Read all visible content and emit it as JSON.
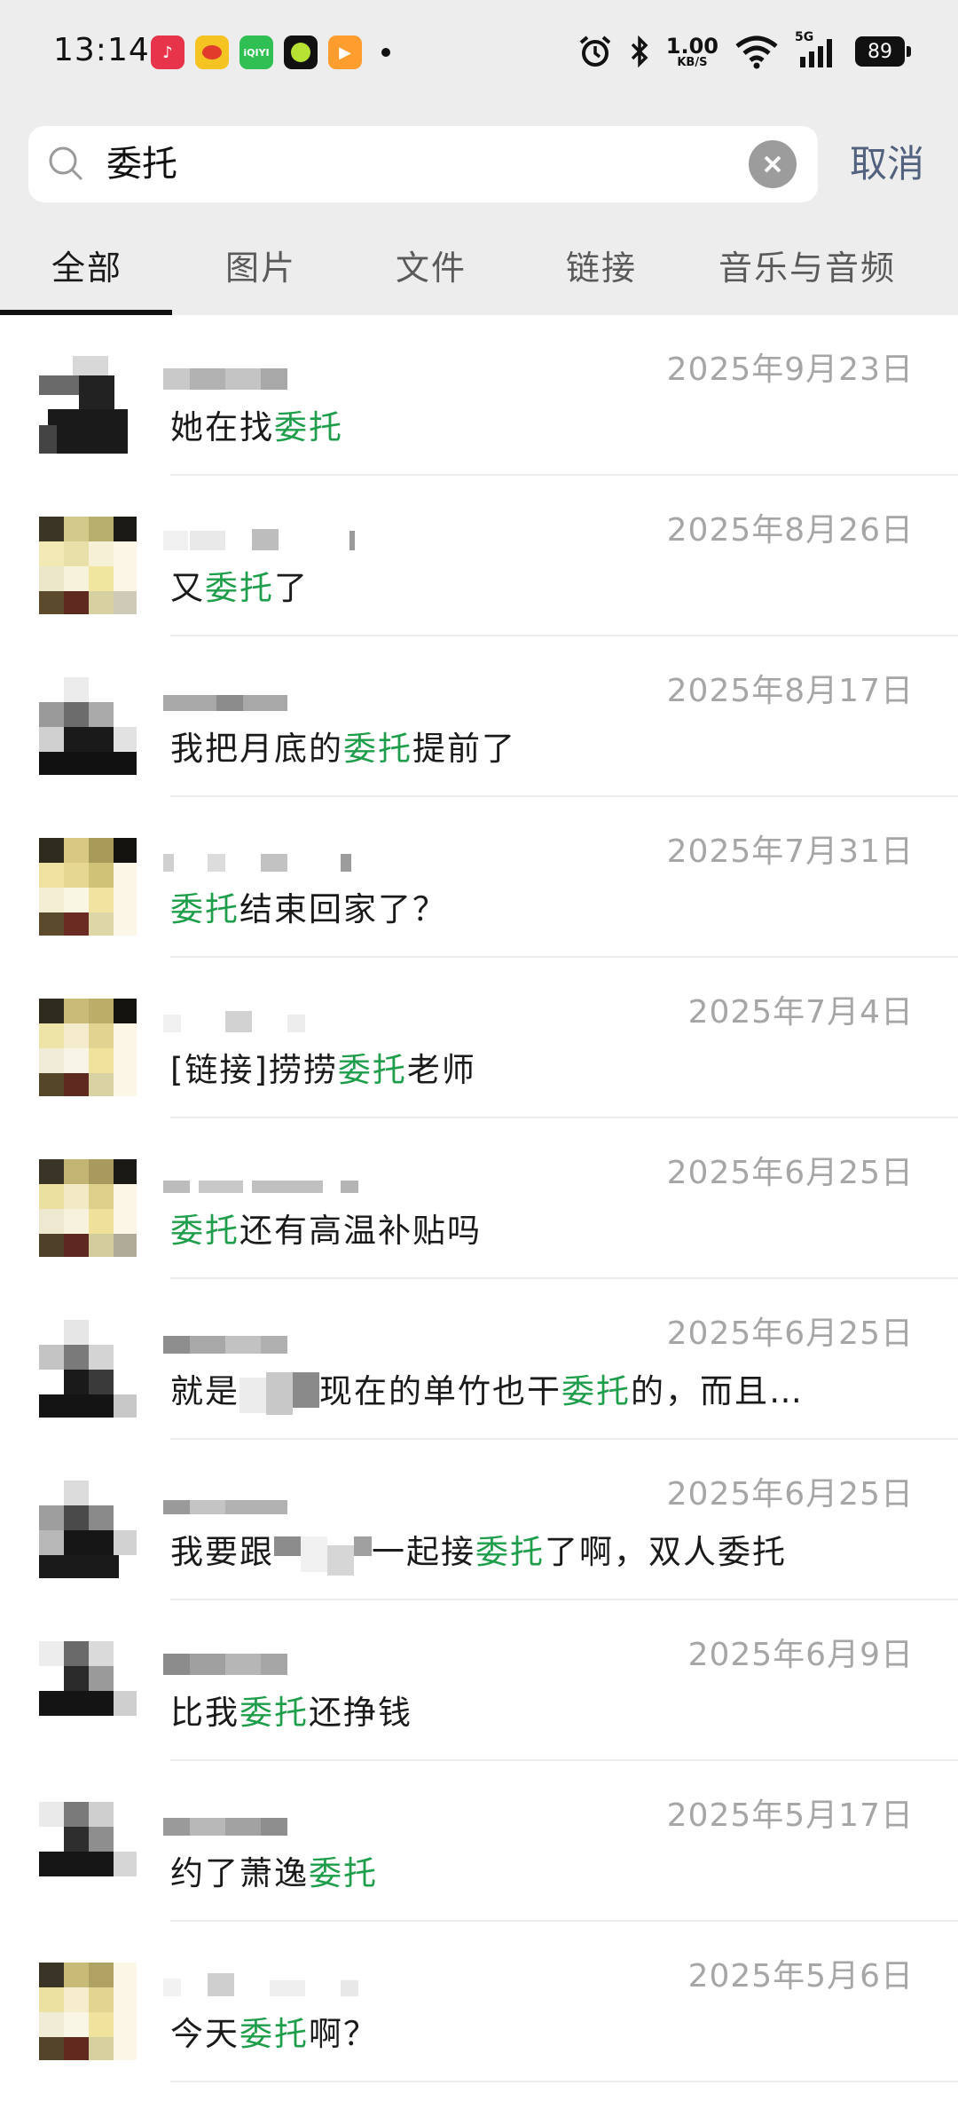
{
  "status_bar": {
    "time": "13:14",
    "net_speed_value": "1.00",
    "net_speed_unit": "KB/S",
    "signal": "5G",
    "battery": "89",
    "app_icons": [
      "music-icon",
      "weibo-icon",
      "iqiyi-icon",
      "green-app-icon",
      "video-app-icon"
    ]
  },
  "search": {
    "query": "委托",
    "cancel_label": "取消"
  },
  "tabs": [
    {
      "label": "全部",
      "active": true
    },
    {
      "label": "图片",
      "active": false
    },
    {
      "label": "文件",
      "active": false
    },
    {
      "label": "链接",
      "active": false
    },
    {
      "label": "音乐与音频",
      "active": false
    }
  ],
  "colors": {
    "highlight": "#1e9d4a",
    "cancel": "#52617e",
    "date": "#a6a6a6",
    "chrome_bg": "#ededed"
  },
  "results": [
    {
      "date": "2025年9月23日",
      "pre": "她在找",
      "hl": "委托",
      "post": ""
    },
    {
      "date": "2025年8月26日",
      "pre": "又",
      "hl": "委托",
      "post": "了"
    },
    {
      "date": "2025年8月17日",
      "pre": "我把月底的",
      "hl": "委托",
      "post": "提前了"
    },
    {
      "date": "2025年7月31日",
      "pre": "",
      "hl": "委托",
      "post": "结束回家了？"
    },
    {
      "date": "2025年7月4日",
      "pre": "[链接]捞捞",
      "hl": "委托",
      "post": "老师"
    },
    {
      "date": "2025年6月25日",
      "pre": "",
      "hl": "委托",
      "post": "还有高温补贴吗"
    },
    {
      "date": "2025年6月25日",
      "pre": "就是",
      "mid": "现在的单竹也干",
      "hl": "委托",
      "post": "的，而且…"
    },
    {
      "date": "2025年6月25日",
      "pre": "我要跟",
      "mid": "一起接",
      "hl": "委托",
      "post": "了啊，双人委托"
    },
    {
      "date": "2025年6月9日",
      "pre": "比我",
      "hl": "委托",
      "post": "还挣钱"
    },
    {
      "date": "2025年5月17日",
      "pre": "约了萧逸",
      "hl": "委托",
      "post": ""
    },
    {
      "date": "2025年5月6日",
      "pre": "今天",
      "hl": "委托",
      "post": "啊？"
    }
  ]
}
